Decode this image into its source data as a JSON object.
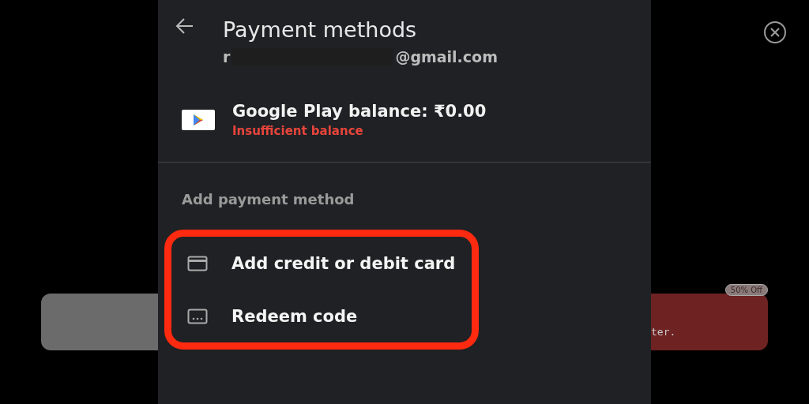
{
  "header": {
    "title": "Payment methods",
    "email_start": "r",
    "email_end": "@gmail.com"
  },
  "balance": {
    "label": "Google Play balance: ₹0.00",
    "status": "Insufficient balance"
  },
  "section": {
    "title": "Add payment method"
  },
  "options": [
    {
      "kind": "card",
      "label": "Add credit or debit card"
    },
    {
      "kind": "code",
      "label": "Redeem code"
    }
  ],
  "background": {
    "right_text": "ter.",
    "badge": "50% Off"
  }
}
